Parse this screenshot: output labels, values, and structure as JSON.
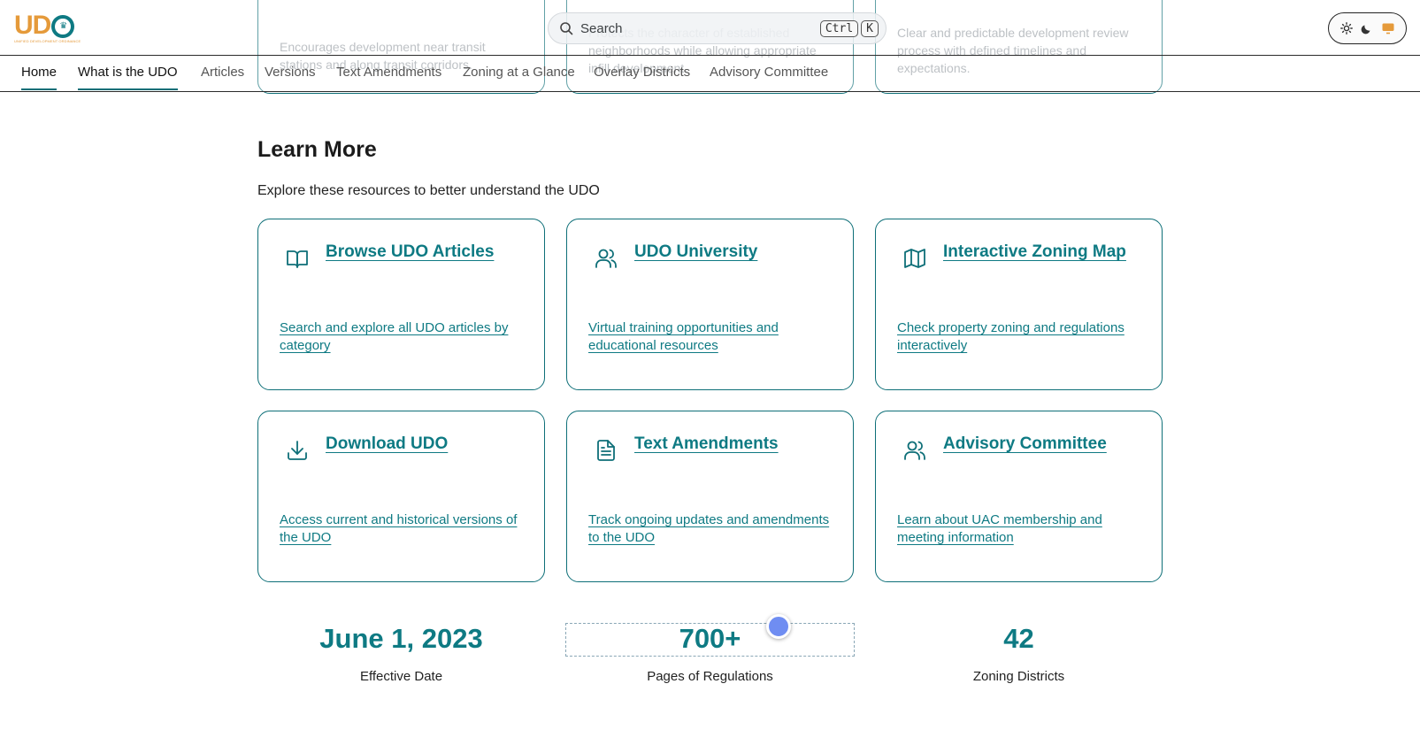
{
  "brand": {
    "logo_text": "UDO",
    "logo_subtext": "UNIFIED DEVELOPMENT ORDINANCE"
  },
  "search": {
    "label": "Search",
    "shortcut_keys": [
      "Ctrl",
      "K"
    ]
  },
  "theme_toggle": {
    "options": [
      "light-icon",
      "dark-icon",
      "system-icon"
    ],
    "selected": "system-icon",
    "accent": "#e59a3a"
  },
  "nav": {
    "items": [
      {
        "label": "Home",
        "state": "active"
      },
      {
        "label": "What is the UDO",
        "state": "current"
      },
      {
        "label": "Articles",
        "state": ""
      },
      {
        "label": "Versions",
        "state": ""
      },
      {
        "label": "Text Amendments",
        "state": ""
      },
      {
        "label": "Zoning at a Glance",
        "state": ""
      },
      {
        "label": "Overlay Districts",
        "state": ""
      },
      {
        "label": "Advisory Committee",
        "state": ""
      }
    ]
  },
  "scrolled_cards": [
    {
      "text": "Encourages development near transit stations and along transit corridors."
    },
    {
      "text": "Protects the character of established neighborhoods while allowing appropriate infill development."
    },
    {
      "text": "Clear and predictable development review process with defined timelines and expectations."
    }
  ],
  "learn_more": {
    "title": "Learn More",
    "subtitle": "Explore these resources to better understand the UDO",
    "cards": [
      {
        "icon": "book-icon",
        "title": "Browse UDO Articles",
        "description": "Search and explore all UDO articles by category"
      },
      {
        "icon": "users-icon",
        "title": "UDO University",
        "description": "Virtual training opportunities and educational resources"
      },
      {
        "icon": "map-icon",
        "title": "Interactive Zoning Map",
        "description": "Check property zoning and regulations interactively"
      },
      {
        "icon": "download-icon",
        "title": "Download UDO",
        "description": "Access current and historical versions of the UDO"
      },
      {
        "icon": "document-icon",
        "title": "Text Amendments",
        "description": "Track ongoing updates and amendments to the UDO"
      },
      {
        "icon": "users-icon",
        "title": "Advisory Committee",
        "description": "Learn about UAC membership and meeting information"
      }
    ]
  },
  "stats": [
    {
      "value": "June 1, 2023",
      "label": "Effective Date"
    },
    {
      "value": "700+",
      "label": "Pages of Regulations"
    },
    {
      "value": "42",
      "label": "Zoning Districts"
    }
  ],
  "colors": {
    "teal": "#0e7a83",
    "border": "#0e6f78",
    "orange": "#e59a3a",
    "cursor": "#6f8df2"
  }
}
